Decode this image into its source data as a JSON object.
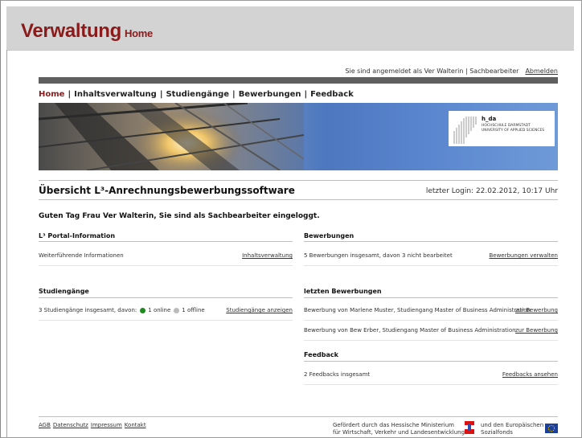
{
  "header": {
    "title": "Verwaltung",
    "subtitle": "Home"
  },
  "status": {
    "text": "Sie sind angemeldet als Ver Walterin | Sachbearbeiter",
    "logout": "Abmelden"
  },
  "nav": {
    "items": [
      "Home",
      "Inhaltsverwaltung",
      "Studiengänge",
      "Bewerbungen",
      "Feedback"
    ],
    "active": "Home",
    "separator": "|"
  },
  "logo": {
    "name": "h_da",
    "line1": "HOCHSCHULE DARMSTADT",
    "line2": "UNIVERSITY OF APPLIED SCIENCES"
  },
  "page": {
    "title": "Übersicht L³-Anrechnungsbewerbungssoftware",
    "last_login": "letzter Login: 22.02.2012, 10:17 Uhr",
    "greeting": "Guten Tag Frau Ver Walterin, Sie sind als Sachbearbeiter eingeloggt."
  },
  "portal": {
    "heading": "L³ Portal-Information",
    "text": "Weiterführende Informationen",
    "link": "Inhaltsverwaltung"
  },
  "studiengaenge": {
    "heading": "Studiengänge",
    "text": "3 Studiengänge insgesamt, davon:",
    "online": "1 online",
    "offline": "1 offline",
    "link": "Studiengänge anzeigen",
    "online_color": "#1e8a1e",
    "offline_color": "#bbbbbb"
  },
  "bewerbungen": {
    "heading": "Bewerbungen",
    "text": "5 Bewerbungen insgesamt, davon 3 nicht bearbeitet",
    "link": "Bewerbungen verwalten"
  },
  "letzte": {
    "heading": "letzten Bewerbungen",
    "items": [
      {
        "text": "Bewerbung von Marlene Muster, Studiengang Master of Business Administration",
        "link": "zur Bewerbung"
      },
      {
        "text": "Bewerbung von Bew Erber, Studiengang Master of Business Administration",
        "link": "zur Bewerbung"
      }
    ]
  },
  "feedback": {
    "heading": "Feedback",
    "text": "2 Feedbacks insgesamt",
    "link": "Feedbacks ansehen"
  },
  "footer": {
    "links": [
      "AGB",
      "Datenschutz",
      "Impressum",
      "Kontakt"
    ],
    "funding1_line1": "Gefördert durch das Hessische Ministerium",
    "funding1_line2": "für Wirtschaft, Verkehr und Landesentwicklung",
    "funding2_line1": "und den Europäischen",
    "funding2_line2": "Sozialfonds"
  },
  "colors": {
    "brand": "#8b1a1a",
    "titlebar": "#d3d3d3",
    "bar": "#5f5f5f",
    "banner": "#5a86cf"
  }
}
